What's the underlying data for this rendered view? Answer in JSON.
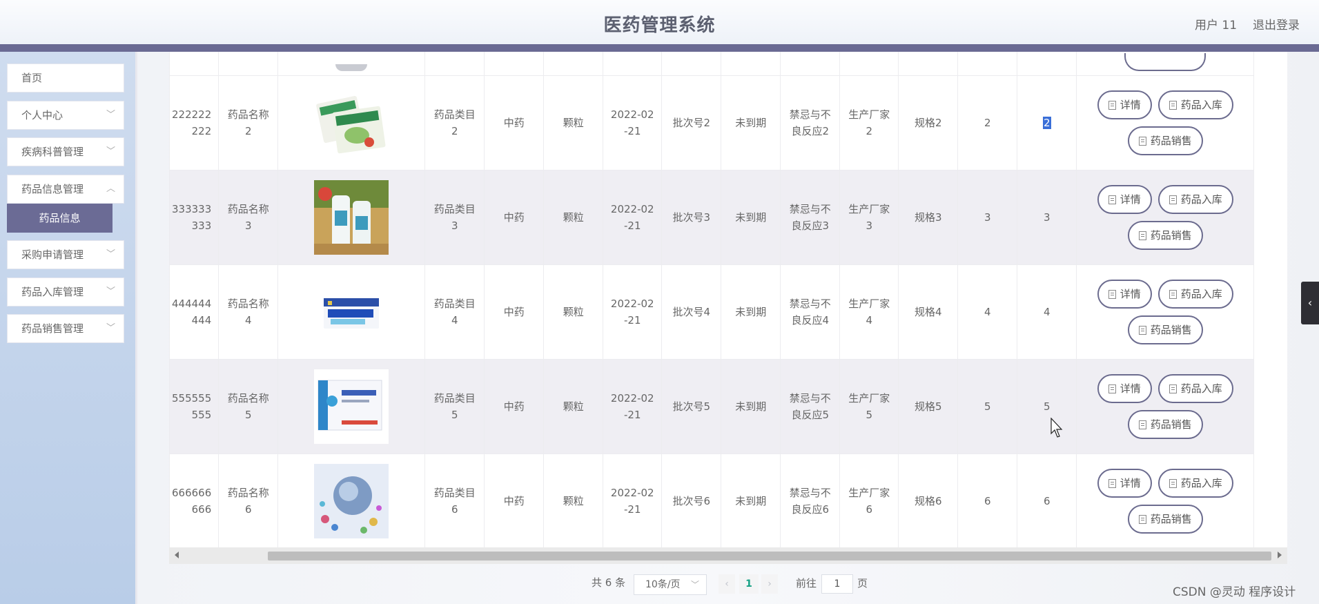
{
  "header": {
    "title": "医药管理系统",
    "user": "用户 11",
    "logout": "退出登录"
  },
  "sidebar": {
    "items": [
      {
        "label": "首页"
      },
      {
        "label": "个人中心"
      },
      {
        "label": "疾病科普管理"
      },
      {
        "label": "药品信息管理"
      },
      {
        "label": "采购申请管理"
      },
      {
        "label": "药品入库管理"
      },
      {
        "label": "药品销售管理"
      }
    ],
    "active_sub": "药品信息"
  },
  "table": {
    "rows": [
      {
        "id1": "222222",
        "id2": "222",
        "name1": "药品名称",
        "name2": "2",
        "cat1": "药品类目",
        "cat2": "2",
        "type": "中药",
        "form": "颗粒",
        "date1": "2022-02",
        "date2": "-21",
        "batch": "批次号2",
        "expiry": "未到期",
        "contra1": "禁忌与不",
        "contra2": "良反应2",
        "maker1": "生产厂家",
        "maker2": "2",
        "spec": "规格2",
        "n1": "2",
        "n2": "2"
      },
      {
        "id1": "333333",
        "id2": "333",
        "name1": "药品名称",
        "name2": "3",
        "cat1": "药品类目",
        "cat2": "3",
        "type": "中药",
        "form": "颗粒",
        "date1": "2022-02",
        "date2": "-21",
        "batch": "批次号3",
        "expiry": "未到期",
        "contra1": "禁忌与不",
        "contra2": "良反应3",
        "maker1": "生产厂家",
        "maker2": "3",
        "spec": "规格3",
        "n1": "3",
        "n2": "3"
      },
      {
        "id1": "444444",
        "id2": "444",
        "name1": "药品名称",
        "name2": "4",
        "cat1": "药品类目",
        "cat2": "4",
        "type": "中药",
        "form": "颗粒",
        "date1": "2022-02",
        "date2": "-21",
        "batch": "批次号4",
        "expiry": "未到期",
        "contra1": "禁忌与不",
        "contra2": "良反应4",
        "maker1": "生产厂家",
        "maker2": "4",
        "spec": "规格4",
        "n1": "4",
        "n2": "4"
      },
      {
        "id1": "555555",
        "id2": "555",
        "name1": "药品名称",
        "name2": "5",
        "cat1": "药品类目",
        "cat2": "5",
        "type": "中药",
        "form": "颗粒",
        "date1": "2022-02",
        "date2": "-21",
        "batch": "批次号5",
        "expiry": "未到期",
        "contra1": "禁忌与不",
        "contra2": "良反应5",
        "maker1": "生产厂家",
        "maker2": "5",
        "spec": "规格5",
        "n1": "5",
        "n2": "5"
      },
      {
        "id1": "666666",
        "id2": "666",
        "name1": "药品名称",
        "name2": "6",
        "cat1": "药品类目",
        "cat2": "6",
        "type": "中药",
        "form": "颗粒",
        "date1": "2022-02",
        "date2": "-21",
        "batch": "批次号6",
        "expiry": "未到期",
        "contra1": "禁忌与不",
        "contra2": "良反应6",
        "maker1": "生产厂家",
        "maker2": "6",
        "spec": "规格6",
        "n1": "6",
        "n2": "6"
      }
    ],
    "actions": {
      "detail": "详情",
      "stock_in": "药品入库",
      "sale": "药品销售"
    }
  },
  "pagination": {
    "total": "共 6 条",
    "page_size": "10条/页",
    "current_page": "1",
    "goto_label": "前往",
    "goto_value": "1",
    "page_unit": "页"
  },
  "watermark": "CSDN @灵动 程序设计",
  "colors": {
    "header_bar": "#6a6a93",
    "active_nav": "#6b6b95",
    "button_border": "#6b6b8e",
    "row_shade": "#efeef3",
    "current_page": "#16a085"
  }
}
